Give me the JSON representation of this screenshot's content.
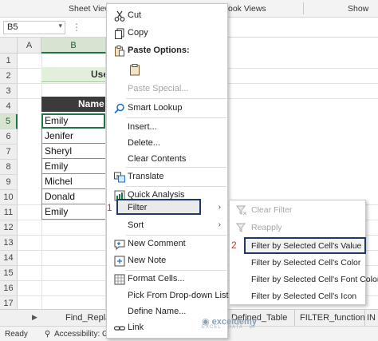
{
  "ribbon": {
    "groups": [
      "Sheet View",
      "ook Views",
      "Show"
    ]
  },
  "formula_bar": {
    "name_box": "B5",
    "dots": "⋮"
  },
  "sheet": {
    "columns": [
      "A",
      "B"
    ],
    "selected_column": "B",
    "rows": [
      "1",
      "2",
      "3",
      "4",
      "5",
      "6",
      "7",
      "8",
      "9",
      "10",
      "11",
      "12",
      "13",
      "14",
      "15",
      "16",
      "17"
    ],
    "selected_row": "5",
    "title_text": "Use",
    "header_text": "Name",
    "names": [
      "Emily",
      "Jenifer",
      "Sheryl",
      "Emily",
      "Michel",
      "Donald",
      "Emily"
    ]
  },
  "context_menu": {
    "items": [
      {
        "label": "Cut",
        "icon": "scissors-icon"
      },
      {
        "label": "Copy",
        "icon": "copy-icon"
      },
      {
        "label": "Paste Options:",
        "icon": "paste-icon"
      },
      {
        "label": "",
        "icon": "paste-clipboard-icon"
      },
      {
        "label": "Paste Special...",
        "icon": ""
      },
      {
        "label": "Smart Lookup",
        "icon": "search-icon"
      },
      {
        "label": "Insert...",
        "icon": ""
      },
      {
        "label": "Delete...",
        "icon": ""
      },
      {
        "label": "Clear Contents",
        "icon": ""
      },
      {
        "label": "Translate",
        "icon": "translate-icon"
      },
      {
        "label": "Quick Analysis",
        "icon": "quick-analysis-icon"
      },
      {
        "label": "Filter",
        "icon": ""
      },
      {
        "label": "Sort",
        "icon": ""
      },
      {
        "label": "New Comment",
        "icon": "comment-icon"
      },
      {
        "label": "New Note",
        "icon": "note-icon"
      },
      {
        "label": "Format Cells...",
        "icon": "format-cells-icon"
      },
      {
        "label": "Pick From Drop-down List...",
        "icon": ""
      },
      {
        "label": "Define Name...",
        "icon": ""
      },
      {
        "label": "Link",
        "icon": "link-icon"
      }
    ],
    "step_one": "1"
  },
  "filter_submenu": {
    "items": [
      {
        "label": "Clear Filter",
        "icon": "clear-filter-icon"
      },
      {
        "label": "Reapply",
        "icon": "reapply-icon"
      },
      {
        "label": "Filter by Selected Cell's Value",
        "icon": ""
      },
      {
        "label": "Filter by Selected Cell's Color",
        "icon": ""
      },
      {
        "label": "Filter by Selected Cell's Font Color",
        "icon": ""
      },
      {
        "label": "Filter by Selected Cell's Icon",
        "icon": ""
      }
    ],
    "step_two": "2"
  },
  "sheet_tabs": [
    "Find_Repla",
    "Defined_Table",
    "FILTER_function",
    "IN"
  ],
  "status_bar": {
    "ready": "Ready",
    "accessibility": "Accessibility: G"
  },
  "watermark": {
    "brand": "exceldemy",
    "tagline": "EXCEL · DATA · BI"
  },
  "colors": {
    "accent_green": "#217346",
    "highlight_navy": "#1f3864",
    "step_red": "#c0392b"
  }
}
